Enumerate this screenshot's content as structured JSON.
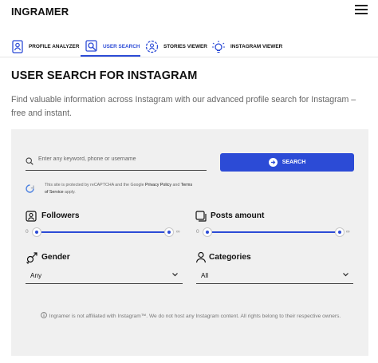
{
  "header": {
    "logo": "INGRAMER"
  },
  "tabs": [
    {
      "label": "PROFILE ANALYZER",
      "icon": "profile-analyzer-icon",
      "active": false
    },
    {
      "label": "USER SEARCH",
      "icon": "user-search-icon",
      "active": true
    },
    {
      "label": "STORIES VIEWER",
      "icon": "stories-viewer-icon",
      "active": false
    },
    {
      "label": "INSTAGRAM VIEWER",
      "icon": "instagram-viewer-icon",
      "active": false
    }
  ],
  "page": {
    "title": "USER SEARCH FOR INSTAGRAM",
    "subtitle": "Find valuable information across Instagram with our advanced profile search for Instagram – free and instant."
  },
  "search": {
    "placeholder": "Enter any keyword, phone or username",
    "button_label": "SEARCH"
  },
  "recaptcha": {
    "prefix": "This site is protected by reCAPTCHA and the Google ",
    "privacy": "Privacy Policy",
    "and": " and ",
    "terms_part1": "Terms",
    "terms_part2": "of Service",
    "suffix": " apply."
  },
  "filters": {
    "followers": {
      "label": "Followers",
      "min_label": "0",
      "max_label": "∞",
      "range": [
        0,
        1
      ]
    },
    "posts": {
      "label": "Posts amount",
      "min_label": "0",
      "max_label": "∞",
      "range": [
        0,
        1
      ]
    },
    "gender": {
      "label": "Gender",
      "value": "Any"
    },
    "categories": {
      "label": "Categories",
      "value": "All"
    }
  },
  "disclaimer": "Ingramer is not affiliated with Instagram™. We do not host any Instagram content. All rights belong to their respective owners.",
  "colors": {
    "accent": "#2c4bd6",
    "panel": "#f0f0f0"
  }
}
